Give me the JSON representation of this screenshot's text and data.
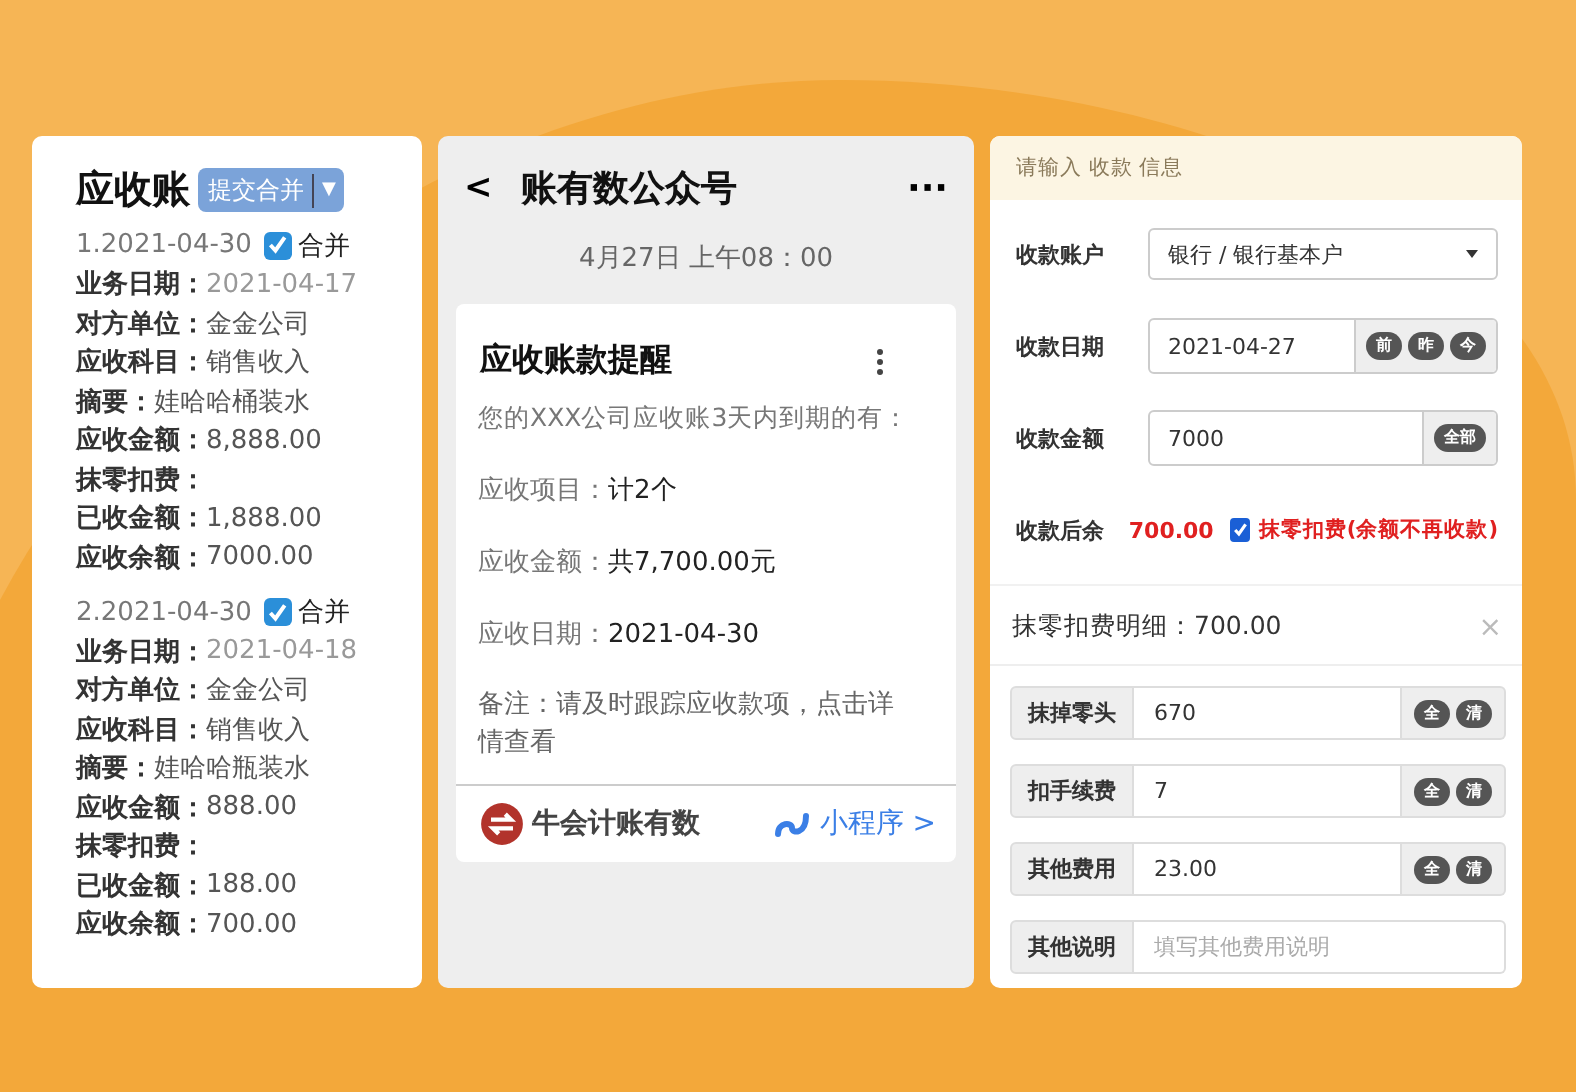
{
  "ledger": {
    "title": "应收账",
    "submit_button": "提交合并",
    "caret": "▼",
    "entries": [
      {
        "header": "1.2021-04-30",
        "merge_checked": true,
        "merge_label": "合并",
        "fields": [
          {
            "label": "业务日期：",
            "value": "2021-04-17",
            "kind": "muted"
          },
          {
            "label": "对方单位：",
            "value": "金金公司",
            "kind": "plain"
          },
          {
            "label": "应收科目：",
            "value": "销售收入",
            "kind": "plain"
          },
          {
            "label": "摘要：",
            "value": "娃哈哈桶装水",
            "kind": "plain"
          },
          {
            "label": "应收金额：",
            "value": "8,888.00",
            "kind": "plain"
          },
          {
            "label": "抹零扣费：",
            "kind": "plain"
          },
          {
            "label": "已收金额：",
            "value": "1,888.00",
            "kind": "plain"
          },
          {
            "label": "应收余额：",
            "value": "7000.00",
            "kind": "plain"
          }
        ]
      },
      {
        "header": "2.2021-04-30",
        "merge_checked": true,
        "merge_label": "合并",
        "fields": [
          {
            "label": "业务日期：",
            "value": "2021-04-18",
            "kind": "muted"
          },
          {
            "label": "对方单位：",
            "value": "金金公司",
            "kind": "plain"
          },
          {
            "label": "应收科目：",
            "value": "销售收入",
            "kind": "plain"
          },
          {
            "label": "摘要：",
            "value": "娃哈哈瓶装水",
            "kind": "plain"
          },
          {
            "label": "应收金额：",
            "value": "888.00",
            "kind": "plain"
          },
          {
            "label": "抹零扣费：",
            "kind": "plain"
          },
          {
            "label": "已收金额：",
            "value": "188.00",
            "kind": "plain"
          },
          {
            "label": "应收余额：",
            "value": "700.00",
            "kind": "plain"
          }
        ]
      }
    ]
  },
  "chat": {
    "back": "<",
    "title": "账有数公众号",
    "more": "···",
    "time": "4月27日 上午08：00",
    "message": {
      "title": "应收账款提醒",
      "intro": "您的XXX公司应收账3天内到期的有：",
      "lines": [
        {
          "label": "应收项目：",
          "value": "计2个"
        },
        {
          "label": "应收金额：",
          "value": "共7,700.00元"
        },
        {
          "label": "应收日期：",
          "value": "2021-04-30"
        }
      ],
      "note": "备注：请及时跟踪应收款项，点击详情查看",
      "brand": "牛会计账有数",
      "link": "小程序 >"
    }
  },
  "form": {
    "hint": "请输入 收款 信息",
    "rows": [
      {
        "kind": "select",
        "label": "收款账户",
        "value": "银行 / 银行基本户"
      },
      {
        "kind": "input",
        "label": "收款日期",
        "value": "2021-04-27",
        "buttons": [
          "前",
          "昨",
          "今"
        ]
      },
      {
        "kind": "input",
        "label": "收款金额",
        "value": "7000",
        "buttons": [
          "全部"
        ]
      },
      {
        "kind": "remain",
        "label": "收款后余",
        "value": "700.00",
        "checked": true,
        "check_label": "抹零扣费(余额不再收款)"
      }
    ],
    "detail": {
      "title": "抹零扣费明细：700.00",
      "close": "×",
      "rows": [
        {
          "label": "抹掉零头",
          "value": "670",
          "buttons": [
            "全",
            "清"
          ]
        },
        {
          "label": "扣手续费",
          "value": "7",
          "buttons": [
            "全",
            "清"
          ]
        },
        {
          "label": "其他费用",
          "value": "23.00",
          "buttons": [
            "全",
            "清"
          ]
        },
        {
          "label": "其他说明",
          "placeholder": "填写其他费用说明"
        }
      ]
    }
  }
}
